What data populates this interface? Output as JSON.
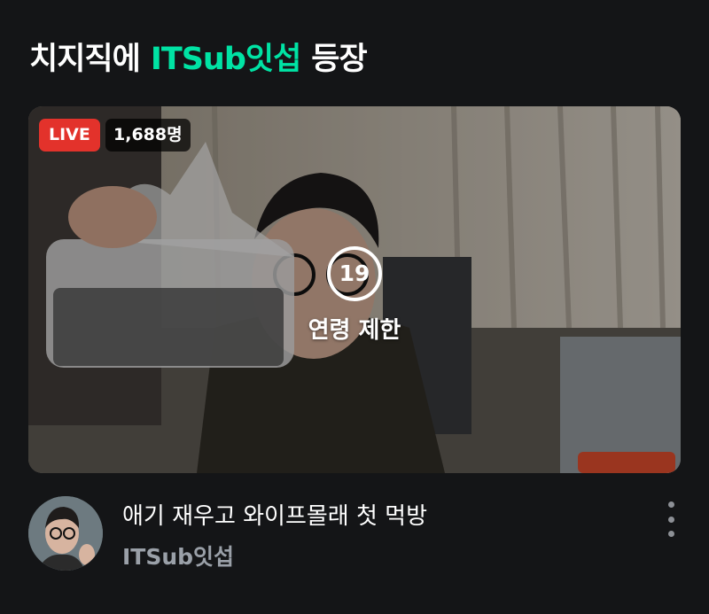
{
  "section": {
    "title_prefix": "치지직에",
    "channel_highlight": "ITSub잇섭",
    "title_suffix": "등장"
  },
  "stream": {
    "live_label": "LIVE",
    "viewer_count": "1,688명",
    "age_badge_number": "19",
    "age_badge_label": "연령 제한",
    "title": "애기 재우고 와이프몰래 첫 먹방",
    "channel_name": "ITSub잇섭"
  },
  "colors": {
    "background": "#141517",
    "accent": "#00e3a4",
    "live_red": "#e3322b",
    "channel_name_gray": "#9aa0a8"
  },
  "icons": {
    "more": "more-vertical-icon"
  }
}
